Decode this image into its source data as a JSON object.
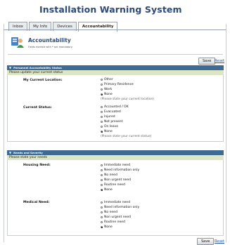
{
  "app": {
    "title": "Installation Warning System"
  },
  "tabs": [
    {
      "label": "Inbox"
    },
    {
      "label": "My Info"
    },
    {
      "label": "Devices"
    },
    {
      "label": "Accountability"
    }
  ],
  "header": {
    "title": "Accountability",
    "subtitle": "Fields marked with * are mandatory."
  },
  "actions": {
    "save_label": "Save",
    "reset_label": "Reset"
  },
  "section1": {
    "title": "Personnel Accountability Status",
    "instruction": "Please update your current status",
    "location": {
      "label": "My Current Location:",
      "options": [
        "Other",
        "Primary Residence",
        "Work",
        "None"
      ],
      "selected": "None",
      "hint": "(Please state your current location)"
    },
    "status": {
      "label": "Current Status:",
      "options": [
        "Accounted / OK",
        "Evacuated",
        "Injured",
        "Not present",
        "On leave",
        "None"
      ],
      "selected": "None",
      "hint": "(Please state your current statue)"
    }
  },
  "section2": {
    "title": "Needs and Severity",
    "instruction": "Please state your needs",
    "housing": {
      "label": "Housing Need:",
      "options": [
        "Immediate need",
        "Need information only",
        "No need",
        "Non urgent need",
        "Routine need",
        "None"
      ],
      "selected": "None"
    },
    "medical": {
      "label": "Medical Need:",
      "options": [
        "Immediate need",
        "Need information only",
        "No need",
        "Non urgent need",
        "Routine need",
        "None"
      ],
      "selected": "None"
    }
  }
}
